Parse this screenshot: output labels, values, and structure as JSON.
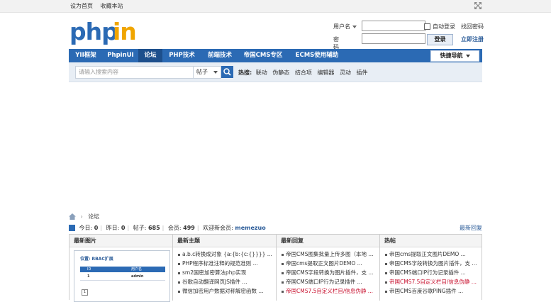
{
  "topbar": {
    "set_home": "设为首页",
    "bookmark": "收藏本站",
    "expand_icon": "expand-arrows-icon"
  },
  "logo": {
    "text": "phpin",
    "color_main": "#2b6ab4",
    "color_accent": "#f0a500"
  },
  "login": {
    "username_label": "用户名",
    "password_label": "密码",
    "auto_login": "自动登录",
    "login_button": "登录",
    "forgot_password": "找回密码",
    "register": "立即注册"
  },
  "nav": {
    "items": [
      {
        "label": "YII框架"
      },
      {
        "label": "PhpinUI"
      },
      {
        "label": "论坛",
        "active": true
      },
      {
        "label": "PHP技术"
      },
      {
        "label": "前端技术"
      },
      {
        "label": "帝国CMS专区"
      },
      {
        "label": "ECMS使用辅助"
      }
    ],
    "quick_nav": "快捷导航"
  },
  "search": {
    "placeholder": "请输入搜索内容",
    "type": "帖子",
    "hot_label": "热搜:",
    "hot": [
      "联动",
      "伪静态",
      "结合项",
      "编辑器",
      "灵动",
      "插件"
    ]
  },
  "breadcrumb": {
    "current": "论坛"
  },
  "stats": {
    "today_label": "今日:",
    "today": "0",
    "yesterday_label": "昨日:",
    "yesterday": "0",
    "posts_label": "帖子:",
    "posts": "685",
    "members_label": "会员:",
    "members": "499",
    "welcome_label": "欢迎新会员:",
    "new_member": "memezuo",
    "latest_reply": "最新回复"
  },
  "columns": {
    "images": {
      "title": "最新图片",
      "thumb": {
        "title": "位置: RBAC扩展",
        "col1": "ID",
        "col2": "用户名",
        "row1_id": "1",
        "row1_name": "admin",
        "box": "1"
      }
    },
    "topics": {
      "title": "最新主题",
      "items": [
        {
          "text": "a.b.c转换成对象 {a:{b:{c:{}}}} ..."
        },
        {
          "text": "PHP程序标准注释的规范准则 ..."
        },
        {
          "text": "sm2国密加密算法php实现"
        },
        {
          "text": "谷歌自动翻译网页JS插件 ..."
        },
        {
          "text": "微信加密用户数据对称解密函数 ..."
        }
      ]
    },
    "replies": {
      "title": "最新回复",
      "items": [
        {
          "text": "帝国CMS图集批量上传多图（本地 ...",
          "red": false
        },
        {
          "text": "帝国cms提取正文图片DEMO ...",
          "red": false
        },
        {
          "text": "帝国CMS字段转换为图片插件，支 ...",
          "red": false
        },
        {
          "text": "帝国CMS端口IP行为记录插件 ...",
          "red": false
        },
        {
          "text": "帝国CMS7.5自定义栏目/信息伪静 ...",
          "red": true
        }
      ]
    },
    "hot": {
      "title": "热帖",
      "items": [
        {
          "text": "帝国cms提取正文图片DEMO ...",
          "red": false
        },
        {
          "text": "帝国CMS字段转换为图片插件，支 ...",
          "red": false
        },
        {
          "text": "帝国CMS端口IP行为记录插件 ...",
          "red": false
        },
        {
          "text": "帝国CMS7.5自定义栏目/信息伪静 ...",
          "red": true
        },
        {
          "text": "帝国CMS百度谷歌PING插件 ...",
          "red": false
        }
      ]
    }
  }
}
